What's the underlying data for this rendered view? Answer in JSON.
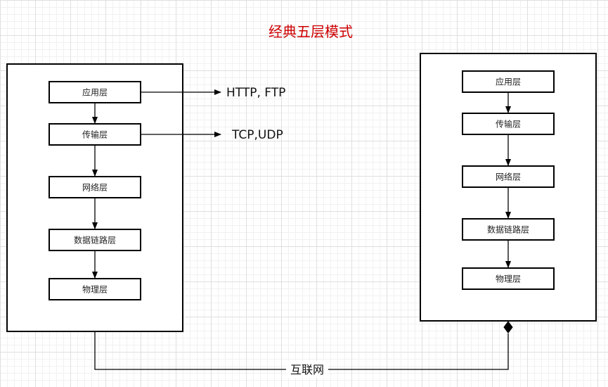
{
  "title": "经典五层模式",
  "colors": {
    "title": "#cc0000",
    "line": "#000000",
    "box_fill": "#ffffff"
  },
  "left_stack": {
    "layers": [
      "应用层",
      "传输层",
      "网络层",
      "数据链路层",
      "物理层"
    ]
  },
  "right_stack": {
    "layers": [
      "应用层",
      "传输层",
      "网络层",
      "数据链路层",
      "物理层"
    ]
  },
  "protocols": {
    "application": "HTTP, FTP",
    "transport": "TCP,UDP"
  },
  "connection_label": "互联网"
}
